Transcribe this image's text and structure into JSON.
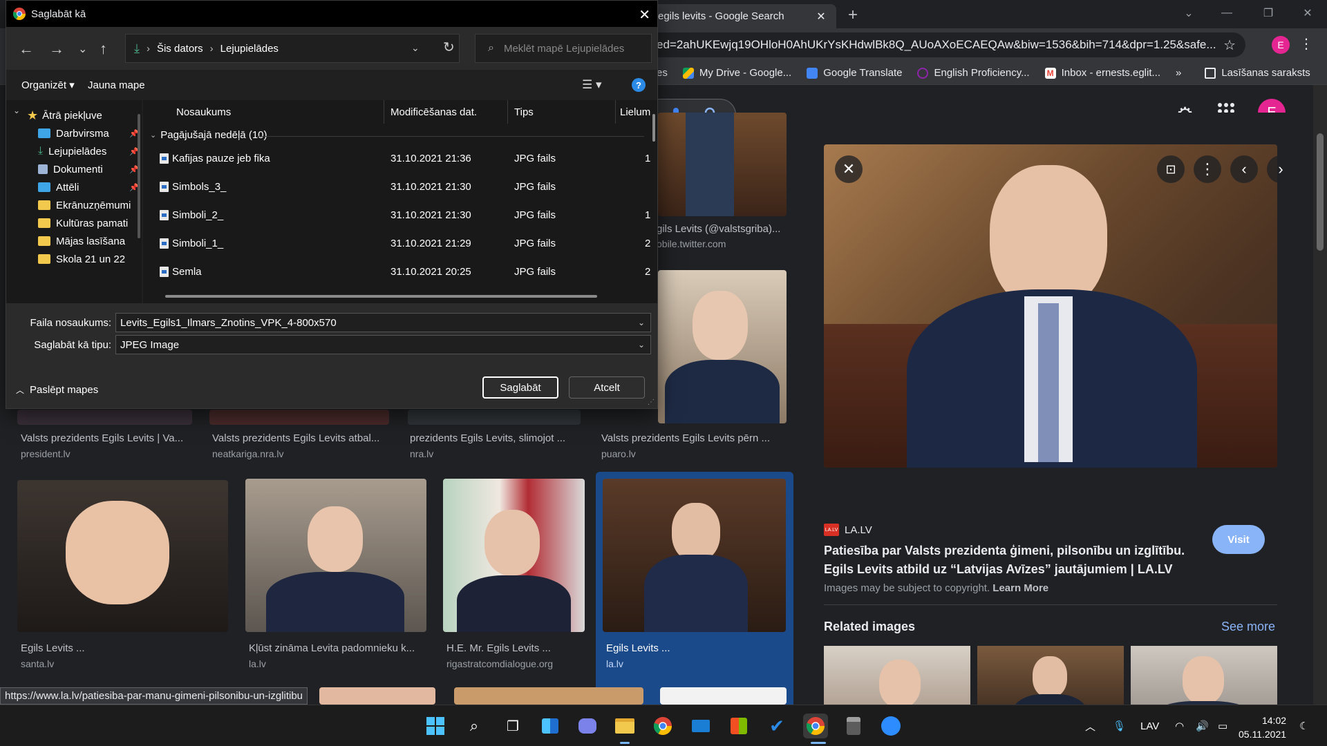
{
  "browser": {
    "tab_title": "egils levits - Google Search",
    "url": "ed=2ahUKEwjq19OHloH0AhUKrYsKHdwlBk8Q_AUoAXoECAEQAw&biw=1536&bih=714&dpr=1.25&safe...",
    "profile_letter": "E",
    "bookmarks": [
      {
        "label": "es",
        "color": "#4285f4"
      },
      {
        "label": "My Drive - Google...",
        "color": "#fbbc04"
      },
      {
        "label": "Google Translate",
        "color": "#4285f4"
      },
      {
        "label": "English Proficiency...",
        "color": "#202124"
      },
      {
        "label": "Inbox - ernests.eglit...",
        "color": "#ea4335"
      }
    ],
    "bookmarks_more": "»",
    "reading_list": "Lasīšanas saraksts",
    "status_url": "https://www.la.lv/patiesiba-par-manu-gimeni-pilsonibu-un-izglitibu"
  },
  "google": {
    "avatar_letter": "E",
    "row1": [
      {
        "title": "Valsts prezidents Egils Levits | Va...",
        "source": "president.lv"
      },
      {
        "title": "Valsts prezidents Egils Levits atbal...",
        "source": "neatkariga.nra.lv"
      },
      {
        "title": "prezidents Egils Levits, slimojot ...",
        "source": "nra.lv"
      },
      {
        "title": "Valsts prezidents Egils Levits pērn ...",
        "source": "puaro.lv"
      }
    ],
    "top_right_card": {
      "title": "gils Levits (@valstsgriba)...",
      "source": "obile.twitter.com"
    },
    "row2": [
      {
        "title": "Egils Levits ...",
        "source": "santa.lv"
      },
      {
        "title": "Kļūst zināma Levita padomnieku k...",
        "source": "la.lv"
      },
      {
        "title": "H.E. Mr. Egils Levits ...",
        "source": "rigastratcomdialogue.org"
      },
      {
        "title": "Egils Levits ...",
        "source": "la.lv"
      }
    ],
    "preview": {
      "source": "LA.LV",
      "source_icon_text": "LA.LV",
      "title": "Patiesība par Valsts prezidenta ģimeni, pilsonību un izglītību. Egils Levits atbild uz “Latvijas Avīzes” jautājumiem | LA.LV",
      "visit": "Visit",
      "copyright": "Images may be subject to copyright.",
      "learn_more": "Learn More",
      "related": "Related images",
      "see_more": "See more"
    }
  },
  "dialog": {
    "title": "Saglabāt kā",
    "path": [
      "Šis dators",
      "Lejupielādes"
    ],
    "search_placeholder": "Meklēt mapē Lejupielādes",
    "organize": "Organizēt",
    "new_folder": "Jauna mape",
    "nav_items": [
      {
        "label": "Ātrā piekļuve",
        "icon": "star",
        "color": "#f2c94c",
        "pinned": false
      },
      {
        "label": "Darbvirsma",
        "icon": "desktop",
        "color": "#3ea6e6",
        "pinned": true
      },
      {
        "label": "Lejupielādes",
        "icon": "download",
        "color": "#4caf8a",
        "pinned": true
      },
      {
        "label": "Dokumenti",
        "icon": "documents",
        "color": "#9db4d6",
        "pinned": true
      },
      {
        "label": "Attēli",
        "icon": "pictures",
        "color": "#3ea6e6",
        "pinned": true
      },
      {
        "label": "Ekrānuzņēmumi",
        "icon": "folder",
        "color": "#f2c94c",
        "pinned": false
      },
      {
        "label": "Kultūras pamati",
        "icon": "folder",
        "color": "#f2c94c",
        "pinned": false
      },
      {
        "label": "Mājas lasīšana",
        "icon": "folder",
        "color": "#f2c94c",
        "pinned": false
      },
      {
        "label": "Skola 21 un 22",
        "icon": "folder",
        "color": "#f2c94c",
        "pinned": false
      }
    ],
    "columns": {
      "name": "Nosaukums",
      "modified": "Modificēšanas dat.",
      "type": "Tips",
      "size": "Lielum"
    },
    "group": "Pagājušajā nedēļā (10)",
    "files": [
      {
        "name": "Kafijas pauze jeb fika",
        "date": "31.10.2021 21:36",
        "type": "JPG fails",
        "size": "1"
      },
      {
        "name": "Simbols_3_",
        "date": "31.10.2021 21:30",
        "type": "JPG fails",
        "size": ""
      },
      {
        "name": "Simboli_2_",
        "date": "31.10.2021 21:30",
        "type": "JPG fails",
        "size": "1"
      },
      {
        "name": "Simboli_1_",
        "date": "31.10.2021 21:29",
        "type": "JPG fails",
        "size": "2"
      },
      {
        "name": "Semla",
        "date": "31.10.2021 20:25",
        "type": "JPG fails",
        "size": "2"
      }
    ],
    "filename_label": "Faila nosaukums:",
    "filename_value": "Levits_Egils1_Ilmars_Znotins_VPK_4-800x570",
    "filetype_label": "Saglabāt kā tipu:",
    "filetype_value": "JPEG Image",
    "hide_folders": "Paslēpt mapes",
    "save": "Saglabāt",
    "cancel": "Atcelt"
  },
  "taskbar": {
    "language": "LAV",
    "time": "14:02",
    "date": "05.11.2021"
  }
}
